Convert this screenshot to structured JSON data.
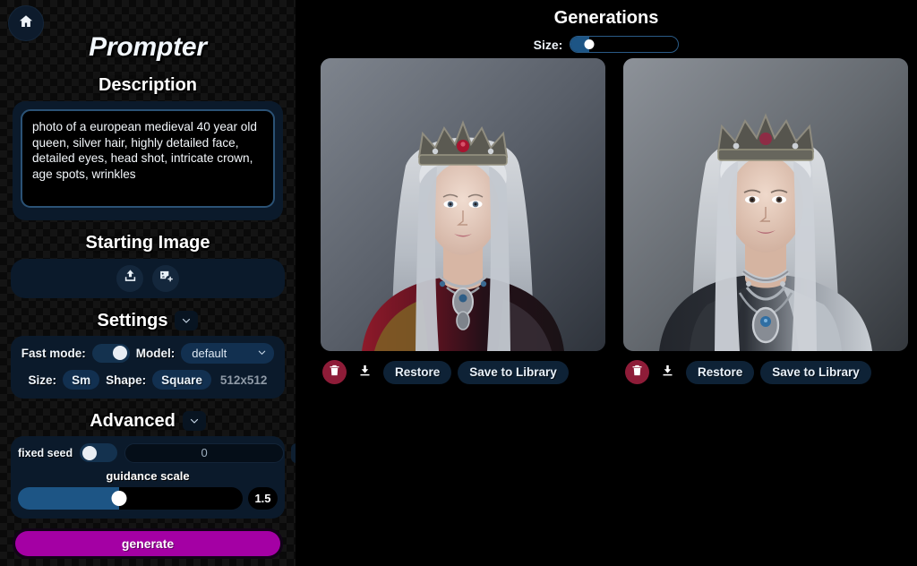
{
  "sidebar": {
    "home_icon": "home-icon",
    "app_title": "Prompter",
    "description": {
      "heading": "Description",
      "value": "photo of a european medieval 40 year old queen, silver hair, highly detailed face, detailed eyes, head shot, intricate crown, age spots, wrinkles",
      "placeholder": "Description"
    },
    "starting_image": {
      "heading": "Starting Image",
      "upload_icon": "upload-icon",
      "add_image_icon": "add-image-icon"
    },
    "settings": {
      "heading": "Settings",
      "chevron_icon": "chevron-down-icon",
      "fast_mode_label": "Fast mode:",
      "fast_mode_on": true,
      "model_label": "Model:",
      "model_value": "default",
      "model_chevron_icon": "chevron-down-icon",
      "size_label": "Size:",
      "size_value": "Sm",
      "shape_label": "Shape:",
      "shape_value": "Square",
      "dimensions": "512x512"
    },
    "advanced": {
      "heading": "Advanced",
      "chevron_icon": "chevron-down-icon",
      "fixed_seed_label": "fixed seed",
      "fixed_seed_on": false,
      "seed_value": "0",
      "seed_placeholder": "0",
      "dice_icon": "dice-icon",
      "guidance_label": "guidance scale",
      "guidance_value": "1.5",
      "guidance_percent": 45
    },
    "generate_label": "generate"
  },
  "main": {
    "title": "Generations",
    "size_label": "Size:",
    "size_percent": 17,
    "cards": [
      {
        "alt": "medieval queen portrait with silver hair and jeweled crown, red robe",
        "delete_icon": "trash-icon",
        "download_icon": "download-icon",
        "restore_label": "Restore",
        "save_label": "Save to Library"
      },
      {
        "alt": "medieval queen portrait with silver hair, jeweled crown and ornate necklace",
        "delete_icon": "trash-icon",
        "download_icon": "download-icon",
        "restore_label": "Restore",
        "save_label": "Save to Library"
      }
    ]
  },
  "colors": {
    "accent_magenta": "#a400a4",
    "panel_navy": "#0b1a2b",
    "slider_blue": "#1d5585",
    "danger_red": "#8e1c38",
    "background": "#000000"
  }
}
